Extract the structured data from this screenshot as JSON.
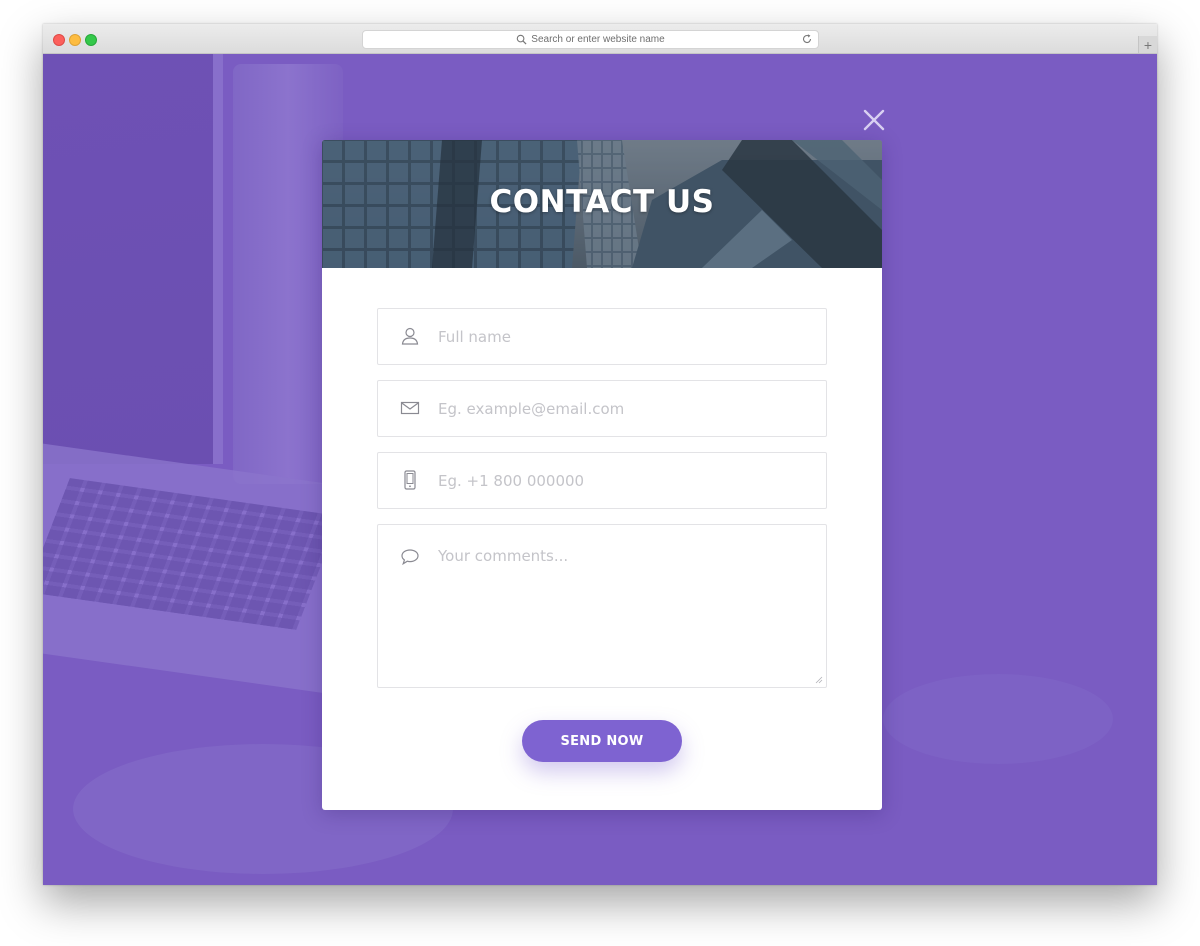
{
  "browser": {
    "address_placeholder": "Search or enter website name",
    "new_tab_label": "+"
  },
  "modal": {
    "title": "CONTACT US",
    "fields": {
      "name": {
        "placeholder": "Full name",
        "icon": "user-icon"
      },
      "email": {
        "placeholder": "Eg. example@email.com",
        "icon": "envelope-icon"
      },
      "phone": {
        "placeholder": "Eg. +1 800 000000",
        "icon": "phone-icon"
      },
      "comments": {
        "placeholder": "Your comments...",
        "icon": "speech-bubble-icon"
      }
    },
    "submit_label": "SEND NOW",
    "close_icon": "close-icon"
  },
  "colors": {
    "overlay": "#7a5cc2",
    "accent": "#7e63d1",
    "header_bg": "#3e4a57",
    "placeholder": "#c4c4c9"
  }
}
